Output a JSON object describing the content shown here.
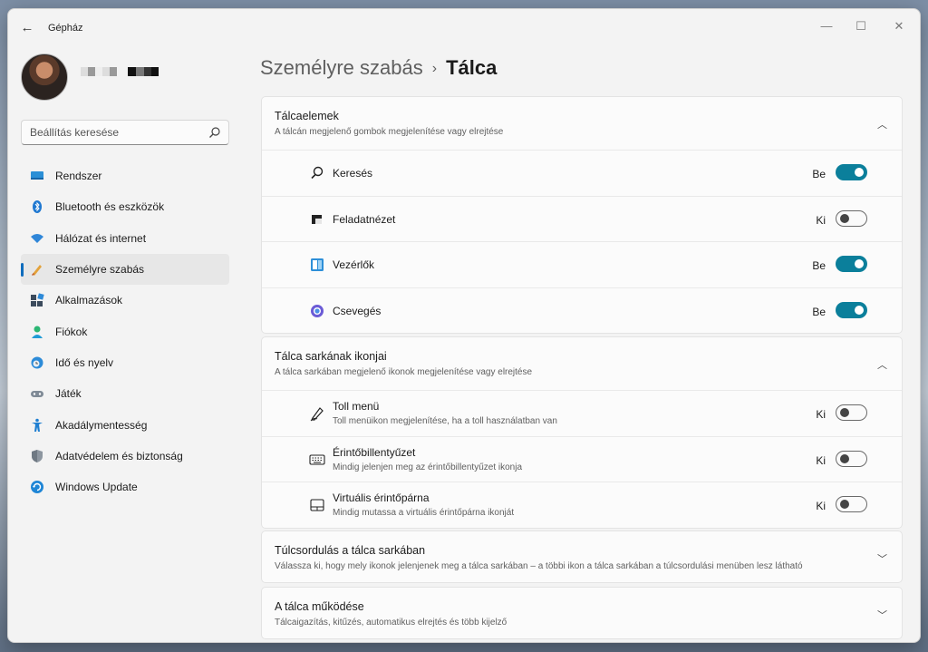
{
  "window": {
    "title": "Gépház",
    "back_glyph": "←",
    "min_glyph": "—",
    "max_glyph": "☐",
    "close_glyph": "✕"
  },
  "search": {
    "placeholder": "Beállítás keresése"
  },
  "nav": {
    "items": [
      {
        "label": "Rendszer",
        "icon": "monitor-icon"
      },
      {
        "label": "Bluetooth és eszközök",
        "icon": "bluetooth-icon"
      },
      {
        "label": "Hálózat és internet",
        "icon": "wifi-icon"
      },
      {
        "label": "Személyre szabás",
        "icon": "brush-icon",
        "active": true
      },
      {
        "label": "Alkalmazások",
        "icon": "apps-icon"
      },
      {
        "label": "Fiókok",
        "icon": "person-icon"
      },
      {
        "label": "Idő és nyelv",
        "icon": "globe-clock-icon"
      },
      {
        "label": "Játék",
        "icon": "gamepad-icon"
      },
      {
        "label": "Akadálymentesség",
        "icon": "accessibility-icon"
      },
      {
        "label": "Adatvédelem és biztonság",
        "icon": "shield-icon"
      },
      {
        "label": "Windows Update",
        "icon": "update-icon"
      }
    ]
  },
  "breadcrumb": {
    "parent": "Személyre szabás",
    "separator": "›",
    "current": "Tálca"
  },
  "sections": {
    "taskbar_items": {
      "title": "Tálcaelemek",
      "subtitle": "A tálcán megjelenő gombok megjelenítése vagy elrejtése",
      "chevron": "︿",
      "rows": [
        {
          "label": "Keresés",
          "state": "Be",
          "on": true,
          "icon": "search-icon"
        },
        {
          "label": "Feladatnézet",
          "state": "Ki",
          "on": false,
          "icon": "task-view-icon"
        },
        {
          "label": "Vezérlők",
          "state": "Be",
          "on": true,
          "icon": "widgets-icon"
        },
        {
          "label": "Csevegés",
          "state": "Be",
          "on": true,
          "icon": "chat-icon"
        }
      ]
    },
    "corner_icons": {
      "title": "Tálca sarkának ikonjai",
      "subtitle": "A tálca sarkában megjelenő ikonok megjelenítése vagy elrejtése",
      "chevron": "︿",
      "rows": [
        {
          "label": "Toll menü",
          "sub": "Toll menüikon megjelenítése, ha a toll használatban van",
          "state": "Ki",
          "on": false,
          "icon": "pen-icon"
        },
        {
          "label": "Érintőbillentyűzet",
          "sub": "Mindig jelenjen meg az érintőbillentyűzet ikonja",
          "state": "Ki",
          "on": false,
          "icon": "keyboard-icon"
        },
        {
          "label": "Virtuális érintőpárna",
          "sub": "Mindig mutassa a virtuális érintőpárna ikonját",
          "state": "Ki",
          "on": false,
          "icon": "touchpad-icon"
        }
      ]
    },
    "overflow": {
      "title": "Túlcsordulás a tálca sarkában",
      "subtitle": "Válassza ki, hogy mely ikonok jelenjenek meg a tálca sarkában – a többi ikon a tálca sarkában a túlcsordulási menüben lesz látható",
      "chevron": "﹀"
    },
    "behavior": {
      "title": "A tálca működése",
      "subtitle": "Tálcaigazítás, kitűzés, automatikus elrejtés és több kijelző",
      "chevron": "﹀"
    }
  },
  "colors": {
    "accent": "#0b7f9b",
    "nav_indicator": "#0f6cbd"
  }
}
